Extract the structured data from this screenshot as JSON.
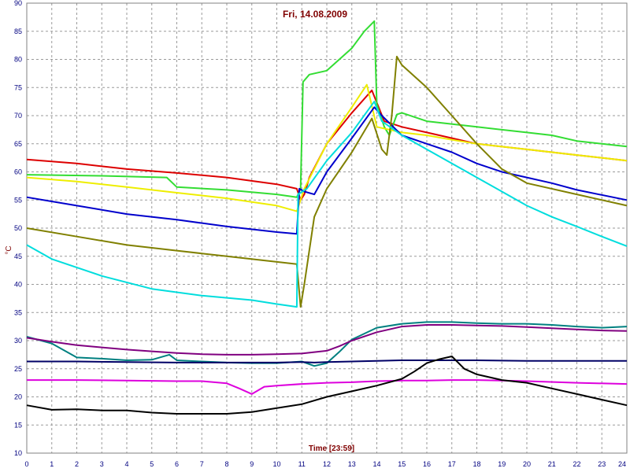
{
  "chart_data": {
    "type": "line",
    "title": "Fri, 14.08.2009",
    "xlabel": "Time [23:59]",
    "ylabel": "°C",
    "xlim": [
      0,
      24
    ],
    "ylim": [
      10,
      90
    ],
    "x_ticks": [
      0,
      1,
      2,
      3,
      4,
      5,
      6,
      7,
      8,
      9,
      10,
      11,
      12,
      13,
      14,
      15,
      16,
      17,
      18,
      19,
      20,
      21,
      22,
      23,
      24
    ],
    "y_ticks": [
      10,
      15,
      20,
      25,
      30,
      35,
      40,
      45,
      50,
      55,
      60,
      65,
      70,
      75,
      80,
      85,
      90
    ],
    "grid": true,
    "series": [
      {
        "color": "#dd0000",
        "x": [
          0,
          2,
          4,
          6,
          8,
          10,
          10.8,
          10.95,
          11.1,
          11.3,
          12,
          13,
          13.8,
          14.3,
          15,
          16,
          17,
          18,
          20,
          22,
          24
        ],
        "y": [
          62.2,
          61.5,
          60.5,
          59.8,
          59,
          57.8,
          57,
          55,
          56,
          59,
          65,
          70.5,
          74.5,
          69,
          68,
          67,
          66,
          65,
          64,
          63,
          62
        ]
      },
      {
        "color": "#33dd33",
        "x": [
          0,
          3,
          5.6,
          6,
          8,
          10,
          10.8,
          10.95,
          11.05,
          11.3,
          12,
          13,
          13.5,
          13.9,
          14,
          14.3,
          14.5,
          14.8,
          15,
          16,
          18,
          20,
          21,
          22,
          23,
          24
        ],
        "y": [
          59.5,
          59.3,
          59,
          57.3,
          56.8,
          56,
          55.5,
          57,
          76,
          77.3,
          78,
          82,
          85,
          86.8,
          72,
          68,
          66.5,
          70.2,
          70.5,
          69,
          68,
          67,
          66.5,
          65.5,
          65,
          64.5
        ]
      },
      {
        "color": "#eeee00",
        "x": [
          0,
          2,
          4,
          6,
          8,
          10,
          10.8,
          11.1,
          12,
          13,
          13.6,
          14,
          15,
          16,
          17,
          18,
          20,
          22,
          24
        ],
        "y": [
          59,
          58.3,
          57.3,
          56.3,
          55.3,
          54,
          53,
          57,
          65,
          71.5,
          75.5,
          68,
          67,
          66.5,
          65.7,
          65,
          64,
          63,
          62
        ]
      },
      {
        "color": "#0000cc",
        "x": [
          0,
          2,
          4,
          6,
          8,
          10,
          10.8,
          10.9,
          11.1,
          11.5,
          12,
          13,
          13.9,
          14.2,
          15,
          16,
          17,
          18,
          19,
          20,
          21,
          22,
          24
        ],
        "y": [
          55.5,
          54,
          52.5,
          51.5,
          50.3,
          49.3,
          49,
          57,
          56.5,
          56,
          60,
          66,
          71.5,
          70,
          66.5,
          65,
          63.5,
          61.5,
          60,
          59,
          58,
          56.8,
          55
        ]
      },
      {
        "color": "#808000",
        "x": [
          0,
          2,
          4,
          6,
          8,
          10,
          10.8,
          10.95,
          11.1,
          11.5,
          12,
          13,
          13.8,
          14.2,
          14.4,
          14.6,
          14.8,
          15,
          16,
          17,
          18,
          19,
          20,
          22,
          24
        ],
        "y": [
          50,
          48.5,
          47,
          46,
          45,
          44,
          43.6,
          36,
          40,
          52,
          57,
          63.5,
          69.5,
          64,
          63,
          70,
          80.5,
          79,
          75,
          70,
          65,
          60.5,
          58,
          56,
          54
        ]
      },
      {
        "color": "#00dddd",
        "x": [
          0,
          1,
          3,
          5,
          7,
          9,
          10,
          10.8,
          10.85,
          11.2,
          12,
          13,
          13.9,
          14.2,
          15,
          16,
          17,
          18,
          19,
          20,
          21,
          22,
          23,
          24
        ],
        "y": [
          47,
          44.5,
          41.5,
          39.2,
          38,
          37.2,
          36.5,
          36,
          56,
          57,
          62,
          67,
          72.5,
          69,
          66.5,
          64,
          61.5,
          59,
          56.5,
          54,
          52,
          50.3,
          48.5,
          46.8
        ]
      },
      {
        "color": "#008080",
        "x": [
          0,
          1,
          2,
          3,
          4,
          5,
          5.7,
          6,
          7,
          8,
          9,
          10,
          11,
          11.5,
          12,
          12.5,
          13,
          14,
          15,
          16,
          17,
          18,
          19,
          20,
          21,
          22,
          23,
          24
        ],
        "y": [
          30.7,
          29.5,
          27,
          26.8,
          26.5,
          26.6,
          27.5,
          26.5,
          26.3,
          26.1,
          26,
          26,
          26.3,
          25.5,
          26,
          28,
          30.2,
          32.3,
          33,
          33.3,
          33.3,
          33.1,
          33,
          33,
          32.8,
          32.5,
          32.3,
          32.5
        ]
      },
      {
        "color": "#800080",
        "x": [
          0,
          1,
          2,
          3,
          4,
          5,
          6,
          7,
          8,
          9,
          10,
          11,
          12,
          12.5,
          13,
          14,
          15,
          16,
          17,
          18,
          19,
          20,
          21,
          22,
          23,
          24
        ],
        "y": [
          30.5,
          29.8,
          29.2,
          28.8,
          28.4,
          28.1,
          27.8,
          27.6,
          27.5,
          27.5,
          27.6,
          27.7,
          28.2,
          29,
          30,
          31.5,
          32.5,
          32.8,
          32.8,
          32.7,
          32.6,
          32.4,
          32.2,
          32,
          31.8,
          31.7
        ]
      },
      {
        "color": "#000066",
        "x": [
          0,
          2,
          4,
          6,
          8,
          10,
          11,
          11.5,
          12,
          13,
          14,
          15,
          16,
          17,
          18,
          20,
          22,
          24
        ],
        "y": [
          26.3,
          26.3,
          26.2,
          26.1,
          26.1,
          26.1,
          26.2,
          26.1,
          26.2,
          26.3,
          26.4,
          26.5,
          26.5,
          26.5,
          26.5,
          26.4,
          26.4,
          26.4
        ]
      },
      {
        "color": "#dd00dd",
        "x": [
          0,
          2,
          4,
          6,
          7,
          8,
          8.5,
          9,
          9.5,
          10,
          11,
          12,
          13,
          14,
          15,
          16,
          17,
          18,
          19,
          20,
          22,
          24
        ],
        "y": [
          23,
          23,
          22.9,
          22.8,
          22.8,
          22.4,
          21.5,
          20.5,
          21.8,
          22,
          22.3,
          22.5,
          22.6,
          22.8,
          22.9,
          22.9,
          23,
          23,
          22.9,
          22.8,
          22.5,
          22.3
        ]
      },
      {
        "color": "#000000",
        "x": [
          0,
          1,
          2,
          3,
          4,
          5,
          6,
          7,
          8,
          9,
          10,
          11,
          12,
          13,
          14,
          15,
          15.5,
          16,
          16.5,
          17,
          17.5,
          18,
          19,
          20,
          21,
          22,
          23,
          24
        ],
        "y": [
          18.5,
          17.7,
          17.8,
          17.6,
          17.6,
          17.2,
          17,
          17,
          17,
          17.3,
          18,
          18.7,
          20,
          21,
          22,
          23.2,
          24.5,
          26,
          26.7,
          27.2,
          25,
          24,
          23,
          22.5,
          21.5,
          20.5,
          19.5,
          18.5
        ]
      }
    ]
  }
}
